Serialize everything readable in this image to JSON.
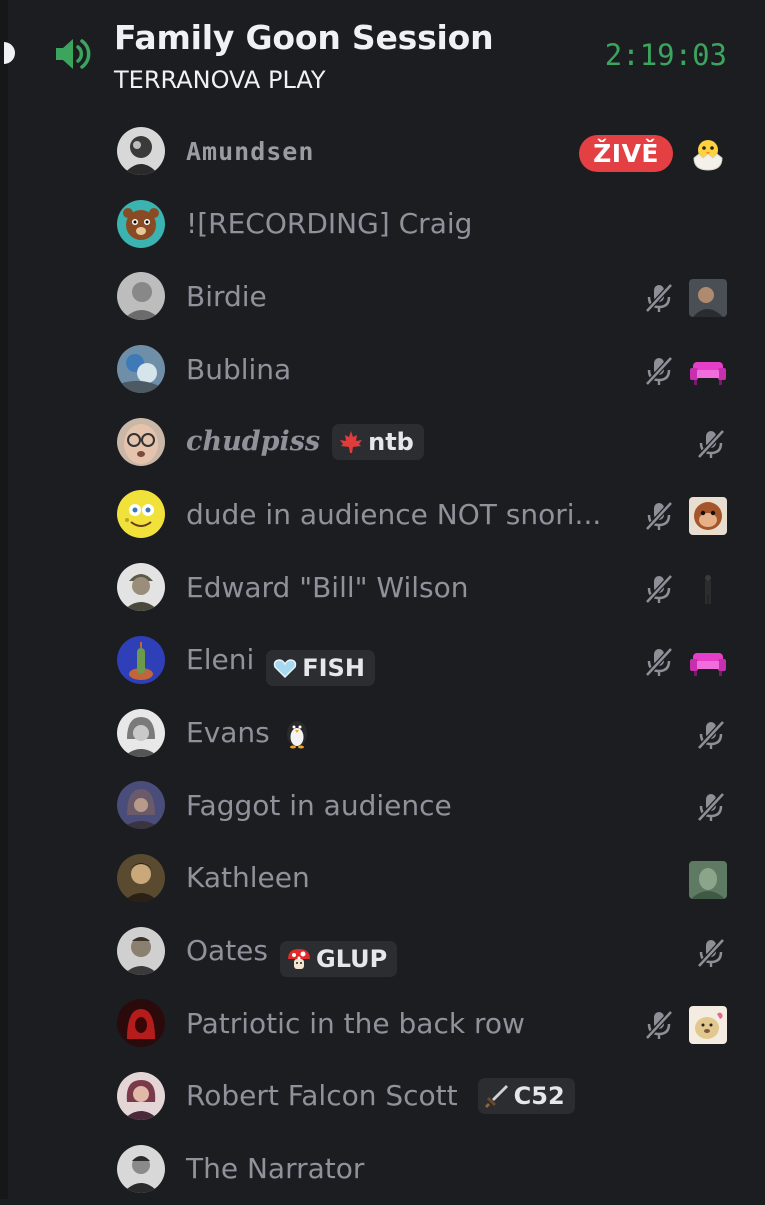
{
  "channel": {
    "name": "Family Goon Session",
    "subtitle": "TERRANOVA PLAY",
    "timer": "2:19:03",
    "accent": "#3ba55d"
  },
  "live_label": "ŽIVĚ",
  "members": [
    {
      "name": "Amundsen",
      "style": "pixel",
      "live": true,
      "muted": false,
      "activity": "hatching-chick"
    },
    {
      "name": "![RECORDING] Craig",
      "style": "normal",
      "muted": false,
      "activity": null
    },
    {
      "name": "Birdie",
      "style": "normal",
      "muted": true,
      "activity": "photo-thumb"
    },
    {
      "name": "Bublina",
      "style": "normal",
      "muted": true,
      "activity": "pink-sofa"
    },
    {
      "name": "chudpiss",
      "style": "goth",
      "tag": {
        "icon": "maple-leaf",
        "text": "ntb"
      },
      "muted": true,
      "activity": null
    },
    {
      "name": "dude in audience NOT snori...",
      "style": "normal",
      "muted": true,
      "activity": "monkey-thumb"
    },
    {
      "name": "Edward \"Bill\" Wilson",
      "style": "normal",
      "muted": true,
      "activity": "figure-thumb"
    },
    {
      "name": "Eleni",
      "style": "normal",
      "tag": {
        "icon": "heart",
        "text": "FISH"
      },
      "muted": true,
      "activity": "pink-sofa"
    },
    {
      "name": "Evans",
      "style": "normal",
      "emoji": "penguin",
      "muted": true,
      "activity": null
    },
    {
      "name": "Faggot in audience",
      "style": "normal",
      "muted": true,
      "activity": null
    },
    {
      "name": "Kathleen",
      "style": "normal",
      "muted": false,
      "activity": "green-thumb"
    },
    {
      "name": "Oates",
      "style": "normal",
      "tag": {
        "icon": "mushroom",
        "text": "GLUP"
      },
      "muted": true,
      "activity": null
    },
    {
      "name": "Patriotic in the back row",
      "style": "normal",
      "muted": true,
      "activity": "otter-thumb"
    },
    {
      "name": "Robert Falcon Scott",
      "style": "normal",
      "tag": {
        "icon": "sword",
        "text": "C52"
      },
      "muted": false,
      "activity": null
    },
    {
      "name": "The Narrator",
      "style": "normal",
      "muted": false,
      "activity": null
    }
  ]
}
